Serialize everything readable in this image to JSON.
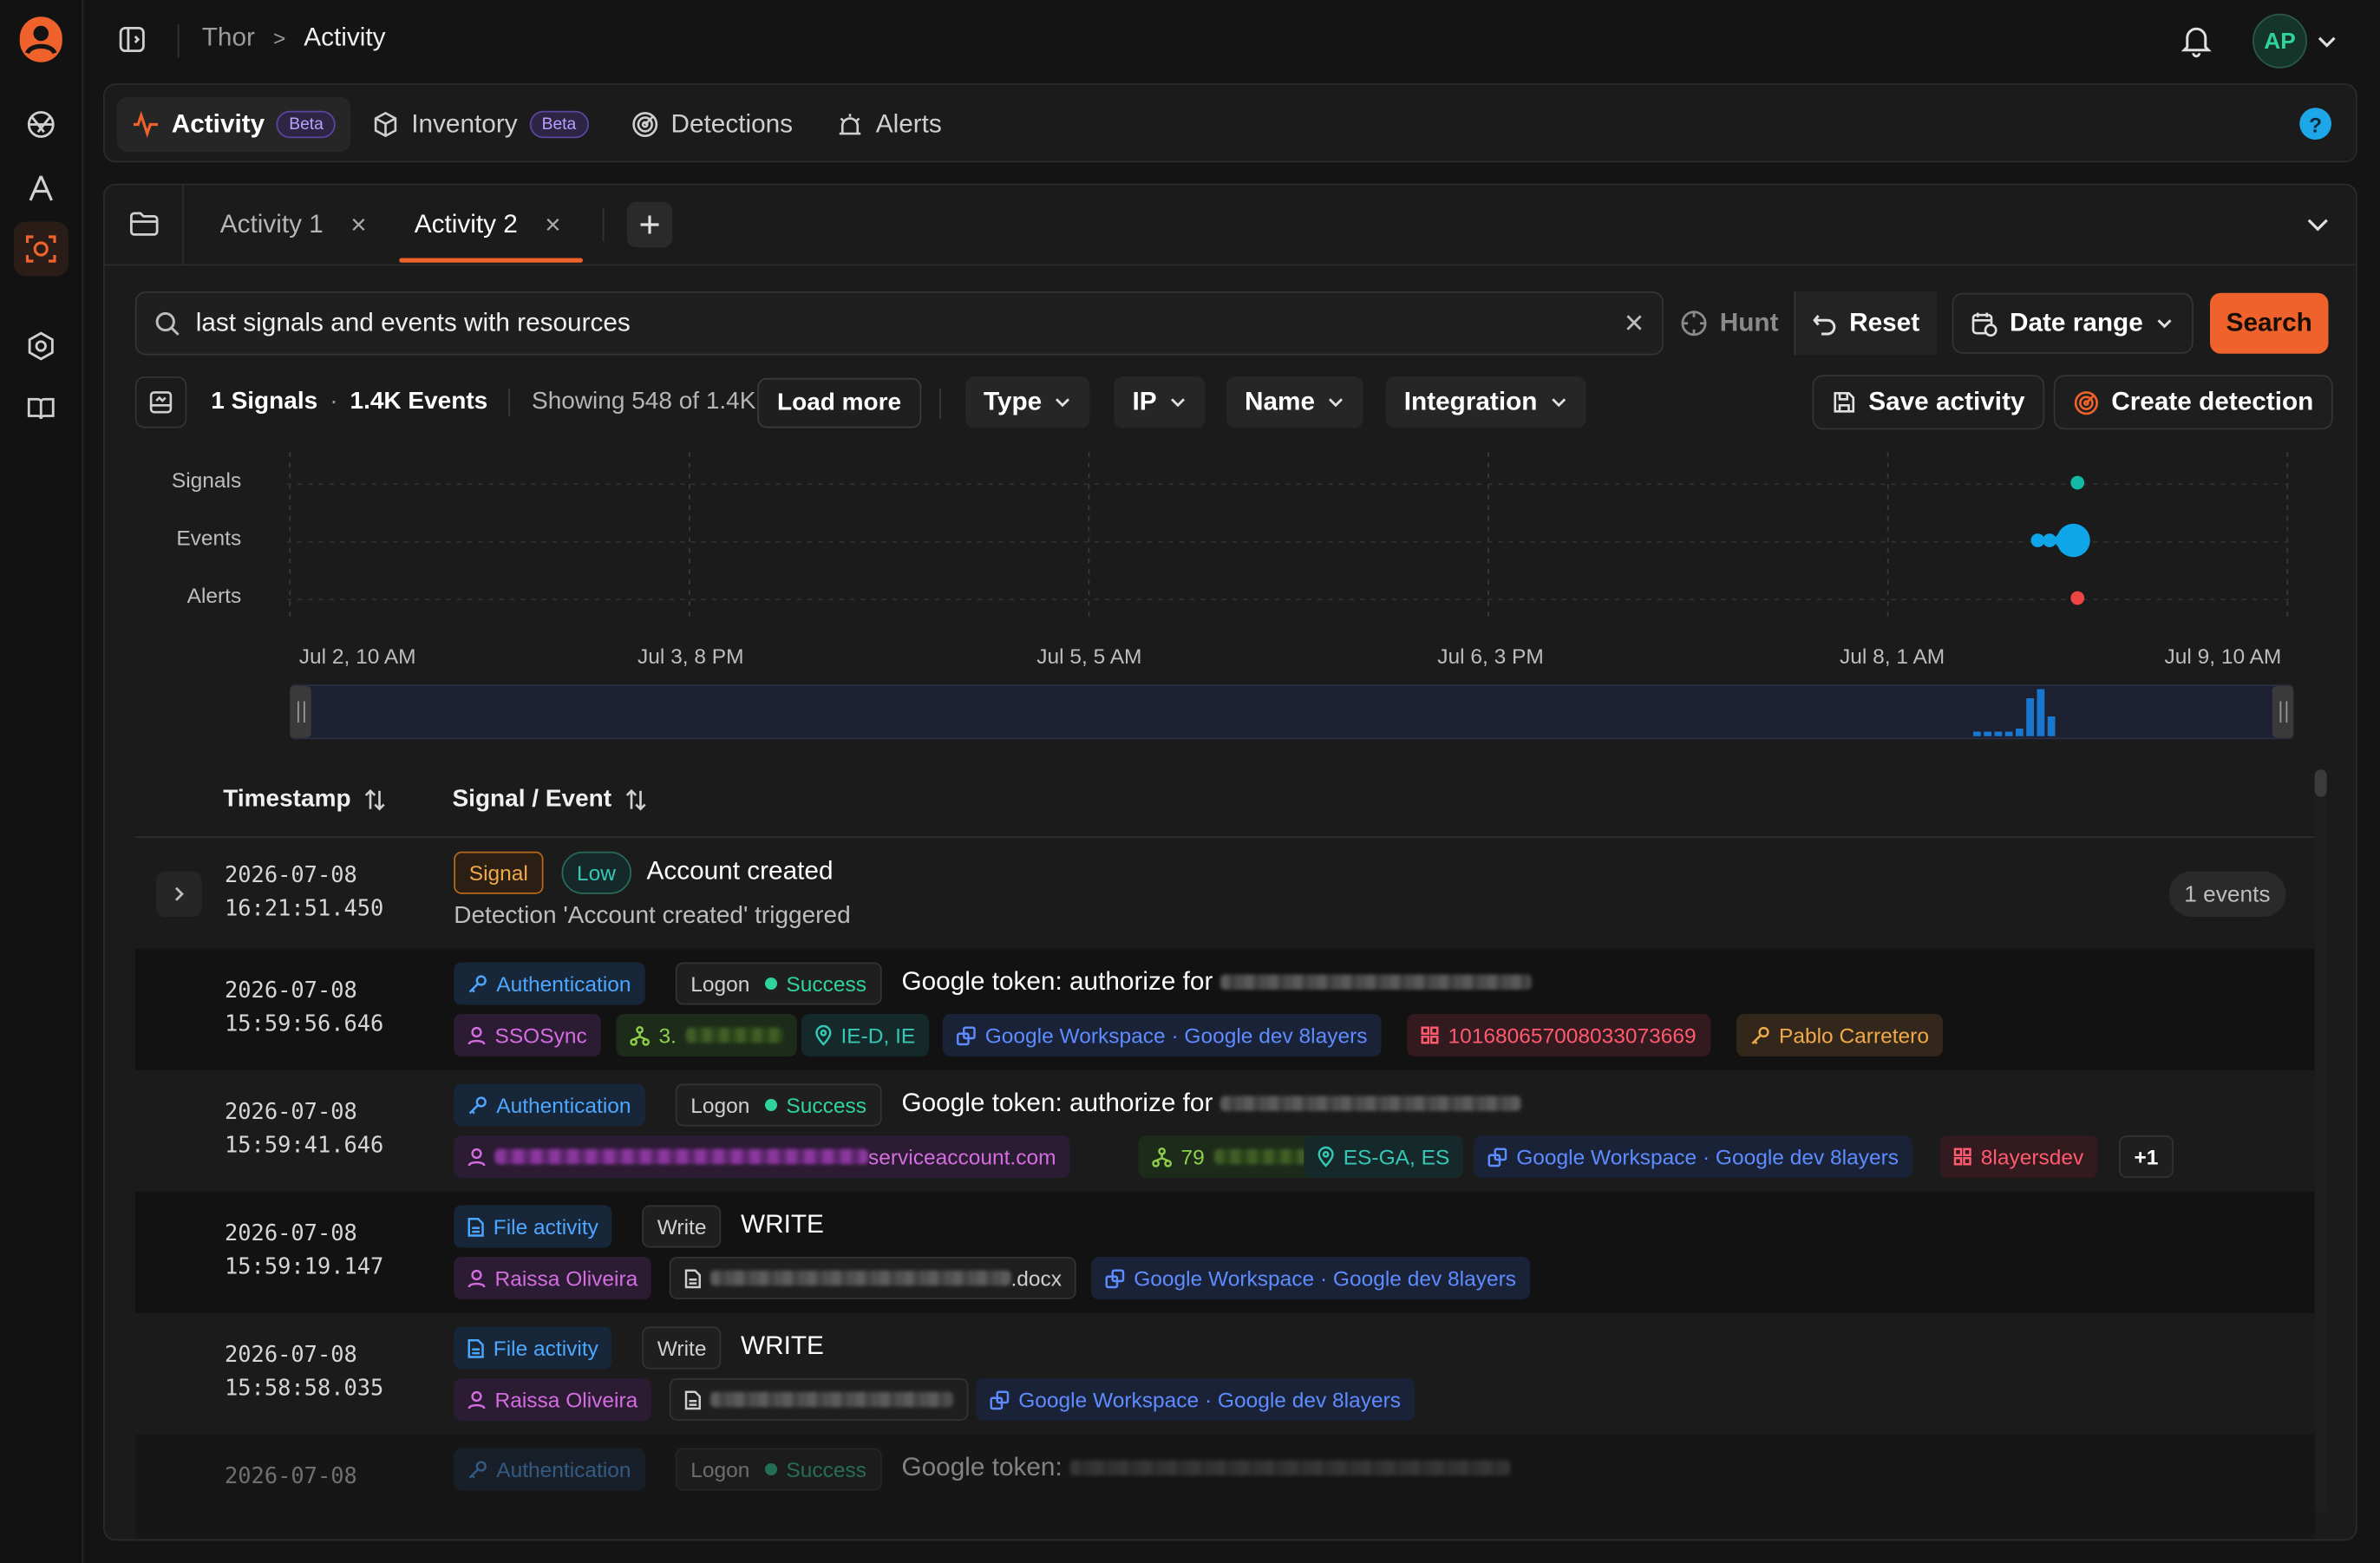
{
  "breadcrumb": {
    "org": "Thor",
    "separator": ">",
    "page": "Activity"
  },
  "user": {
    "initials": "AP"
  },
  "nav_tabs": [
    {
      "label": "Activity",
      "badge": "Beta",
      "icon": "activity-icon"
    },
    {
      "label": "Inventory",
      "badge": "Beta",
      "icon": "cube-icon"
    },
    {
      "label": "Detections",
      "icon": "radar-icon"
    },
    {
      "label": "Alerts",
      "icon": "siren-icon"
    }
  ],
  "work_tabs": [
    {
      "label": "Activity 1",
      "close": "×"
    },
    {
      "label": "Activity 2",
      "close": "×"
    }
  ],
  "search": {
    "value": "last signals and events with resources",
    "clear": "×"
  },
  "toolbar": {
    "hunt": "Hunt",
    "reset": "Reset",
    "date_range": "Date range",
    "search": "Search"
  },
  "summary": {
    "signals": "1 Signals",
    "dot": "·",
    "events": "1.4K Events",
    "showing": "Showing 548 of 1.4K",
    "load_more": "Load more"
  },
  "filters": {
    "type": "Type",
    "ip": "IP",
    "name": "Name",
    "integration": "Integration"
  },
  "actions": {
    "save": "Save activity",
    "create_detection": "Create detection"
  },
  "chart_data": {
    "type": "scatter",
    "rows": [
      "Signals",
      "Events",
      "Alerts"
    ],
    "x_ticks": [
      "Jul 2, 10 AM",
      "Jul 3, 8 PM",
      "Jul 5, 5 AM",
      "Jul 6, 3 PM",
      "Jul 8, 1 AM",
      "Jul 9, 10 AM"
    ],
    "points": [
      {
        "row": "Signals",
        "x": "Jul 8, 16:21",
        "count": 1
      },
      {
        "row": "Events",
        "x": "Jul 8, 13:00",
        "count": 1
      },
      {
        "row": "Events",
        "x": "Jul 8, 14:00",
        "count": 1
      },
      {
        "row": "Events",
        "x": "Jul 8, 15:00",
        "count": 1
      },
      {
        "row": "Events",
        "x": "Jul 8, 16:00",
        "count": 5
      },
      {
        "row": "Events",
        "x": "Jul 8, 16:30",
        "count": 1
      },
      {
        "row": "Alerts",
        "x": "Jul 8, 16:21",
        "count": 1
      }
    ],
    "colors": {
      "Signals": "#14b8a6",
      "Events": "#0ea5e9",
      "Alerts": "#ef4444"
    },
    "grid": true
  },
  "table": {
    "headers": {
      "timestamp": "Timestamp",
      "signal_event": "Signal / Event"
    },
    "signal_row": {
      "date": "2026-07-08",
      "time": "16:21:51.450",
      "badge": "Signal",
      "severity": "Low",
      "title": "Account created",
      "subtitle": "Detection 'Account created' triggered",
      "events_count": "1 events"
    },
    "rows": [
      {
        "date": "2026-07-08",
        "time": "15:59:56.646",
        "category": "Authentication",
        "action": "Logon",
        "status": "Success",
        "title": "Google token: authorize for",
        "actor": "SSOSync",
        "ip_prefix": "3.",
        "location": "IE-D, IE",
        "integration": "Google Workspace · Google dev 8layers",
        "resource": "101680657008033073669",
        "person": "Pablo Carretero"
      },
      {
        "date": "2026-07-08",
        "time": "15:59:41.646",
        "category": "Authentication",
        "action": "Logon",
        "status": "Success",
        "title": "Google token: authorize for",
        "actor_suffix": "serviceaccount.com",
        "ip_prefix": "79",
        "location": "ES-GA, ES",
        "integration": "Google Workspace · Google dev 8layers",
        "resource": "8layersdev",
        "more": "+1"
      },
      {
        "date": "2026-07-08",
        "time": "15:59:19.147",
        "category": "File activity",
        "action": "Write",
        "title": "WRITE",
        "actor": "Raissa Oliveira",
        "file_suffix": ".docx",
        "integration": "Google Workspace · Google dev 8layers"
      },
      {
        "date": "2026-07-08",
        "time": "15:58:58.035",
        "category": "File activity",
        "action": "Write",
        "title": "WRITE",
        "actor": "Raissa Oliveira",
        "integration": "Google Workspace · Google dev 8layers"
      },
      {
        "date": "2026-07-08",
        "category": "Authentication",
        "action": "Logon",
        "status": "Success",
        "title": "Google token:"
      }
    ]
  }
}
